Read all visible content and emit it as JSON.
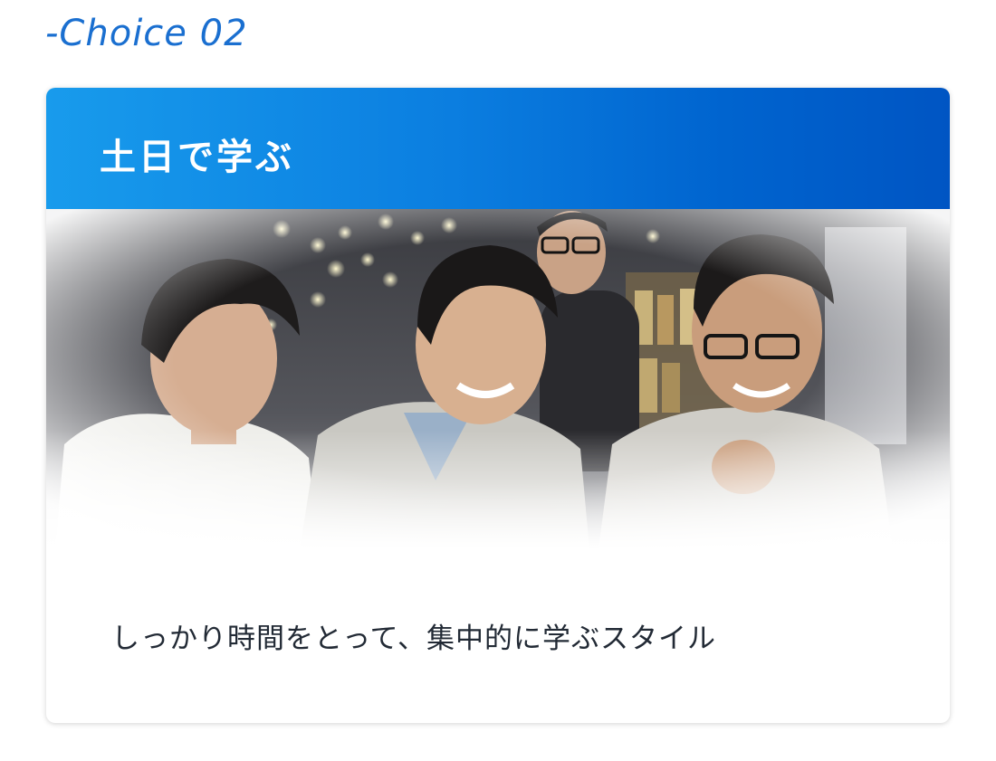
{
  "heading": {
    "choice_label": "-Choice 02"
  },
  "card": {
    "title": "土日で学ぶ",
    "description": "しっかり時間をとって、集中的に学ぶスタイル",
    "photo_alt": "people-smiling-around-laptop-photo"
  },
  "colors": {
    "accent": "#1a6fd0",
    "header_start": "#189bec",
    "header_end": "#0055c3",
    "text": "#222a35"
  }
}
